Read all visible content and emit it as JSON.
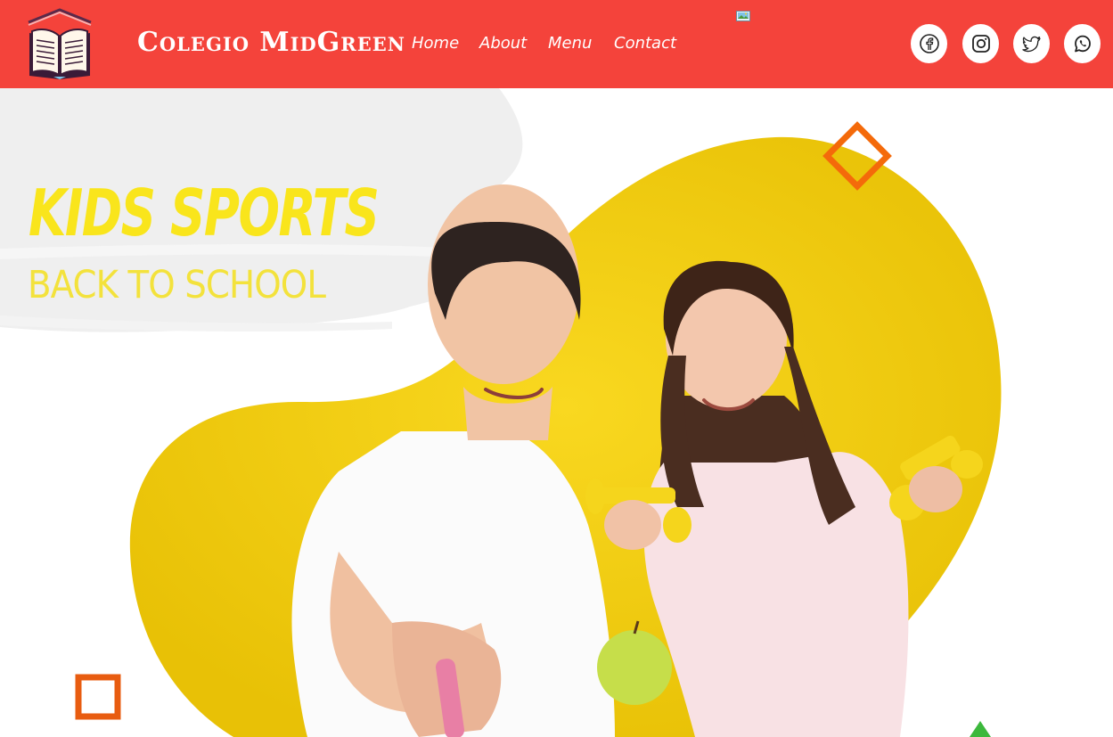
{
  "navbar": {
    "brand": "Colegio MidGreen",
    "links": [
      "Home",
      "About",
      "Menu",
      "Contact"
    ],
    "social": [
      "facebook-icon",
      "instagram-icon",
      "twitter-icon",
      "whatsapp-icon"
    ],
    "colors": {
      "background": "#f4433b",
      "text": "#ffffff"
    }
  },
  "hero": {
    "headline": "KIDS SPORTS",
    "subheadline": "BACK TO SCHOOL",
    "colors": {
      "headline": "#f9e51c",
      "blob": "#f0cc0c",
      "accent": "#f46a0a",
      "triangle": "#3cb83c"
    }
  }
}
